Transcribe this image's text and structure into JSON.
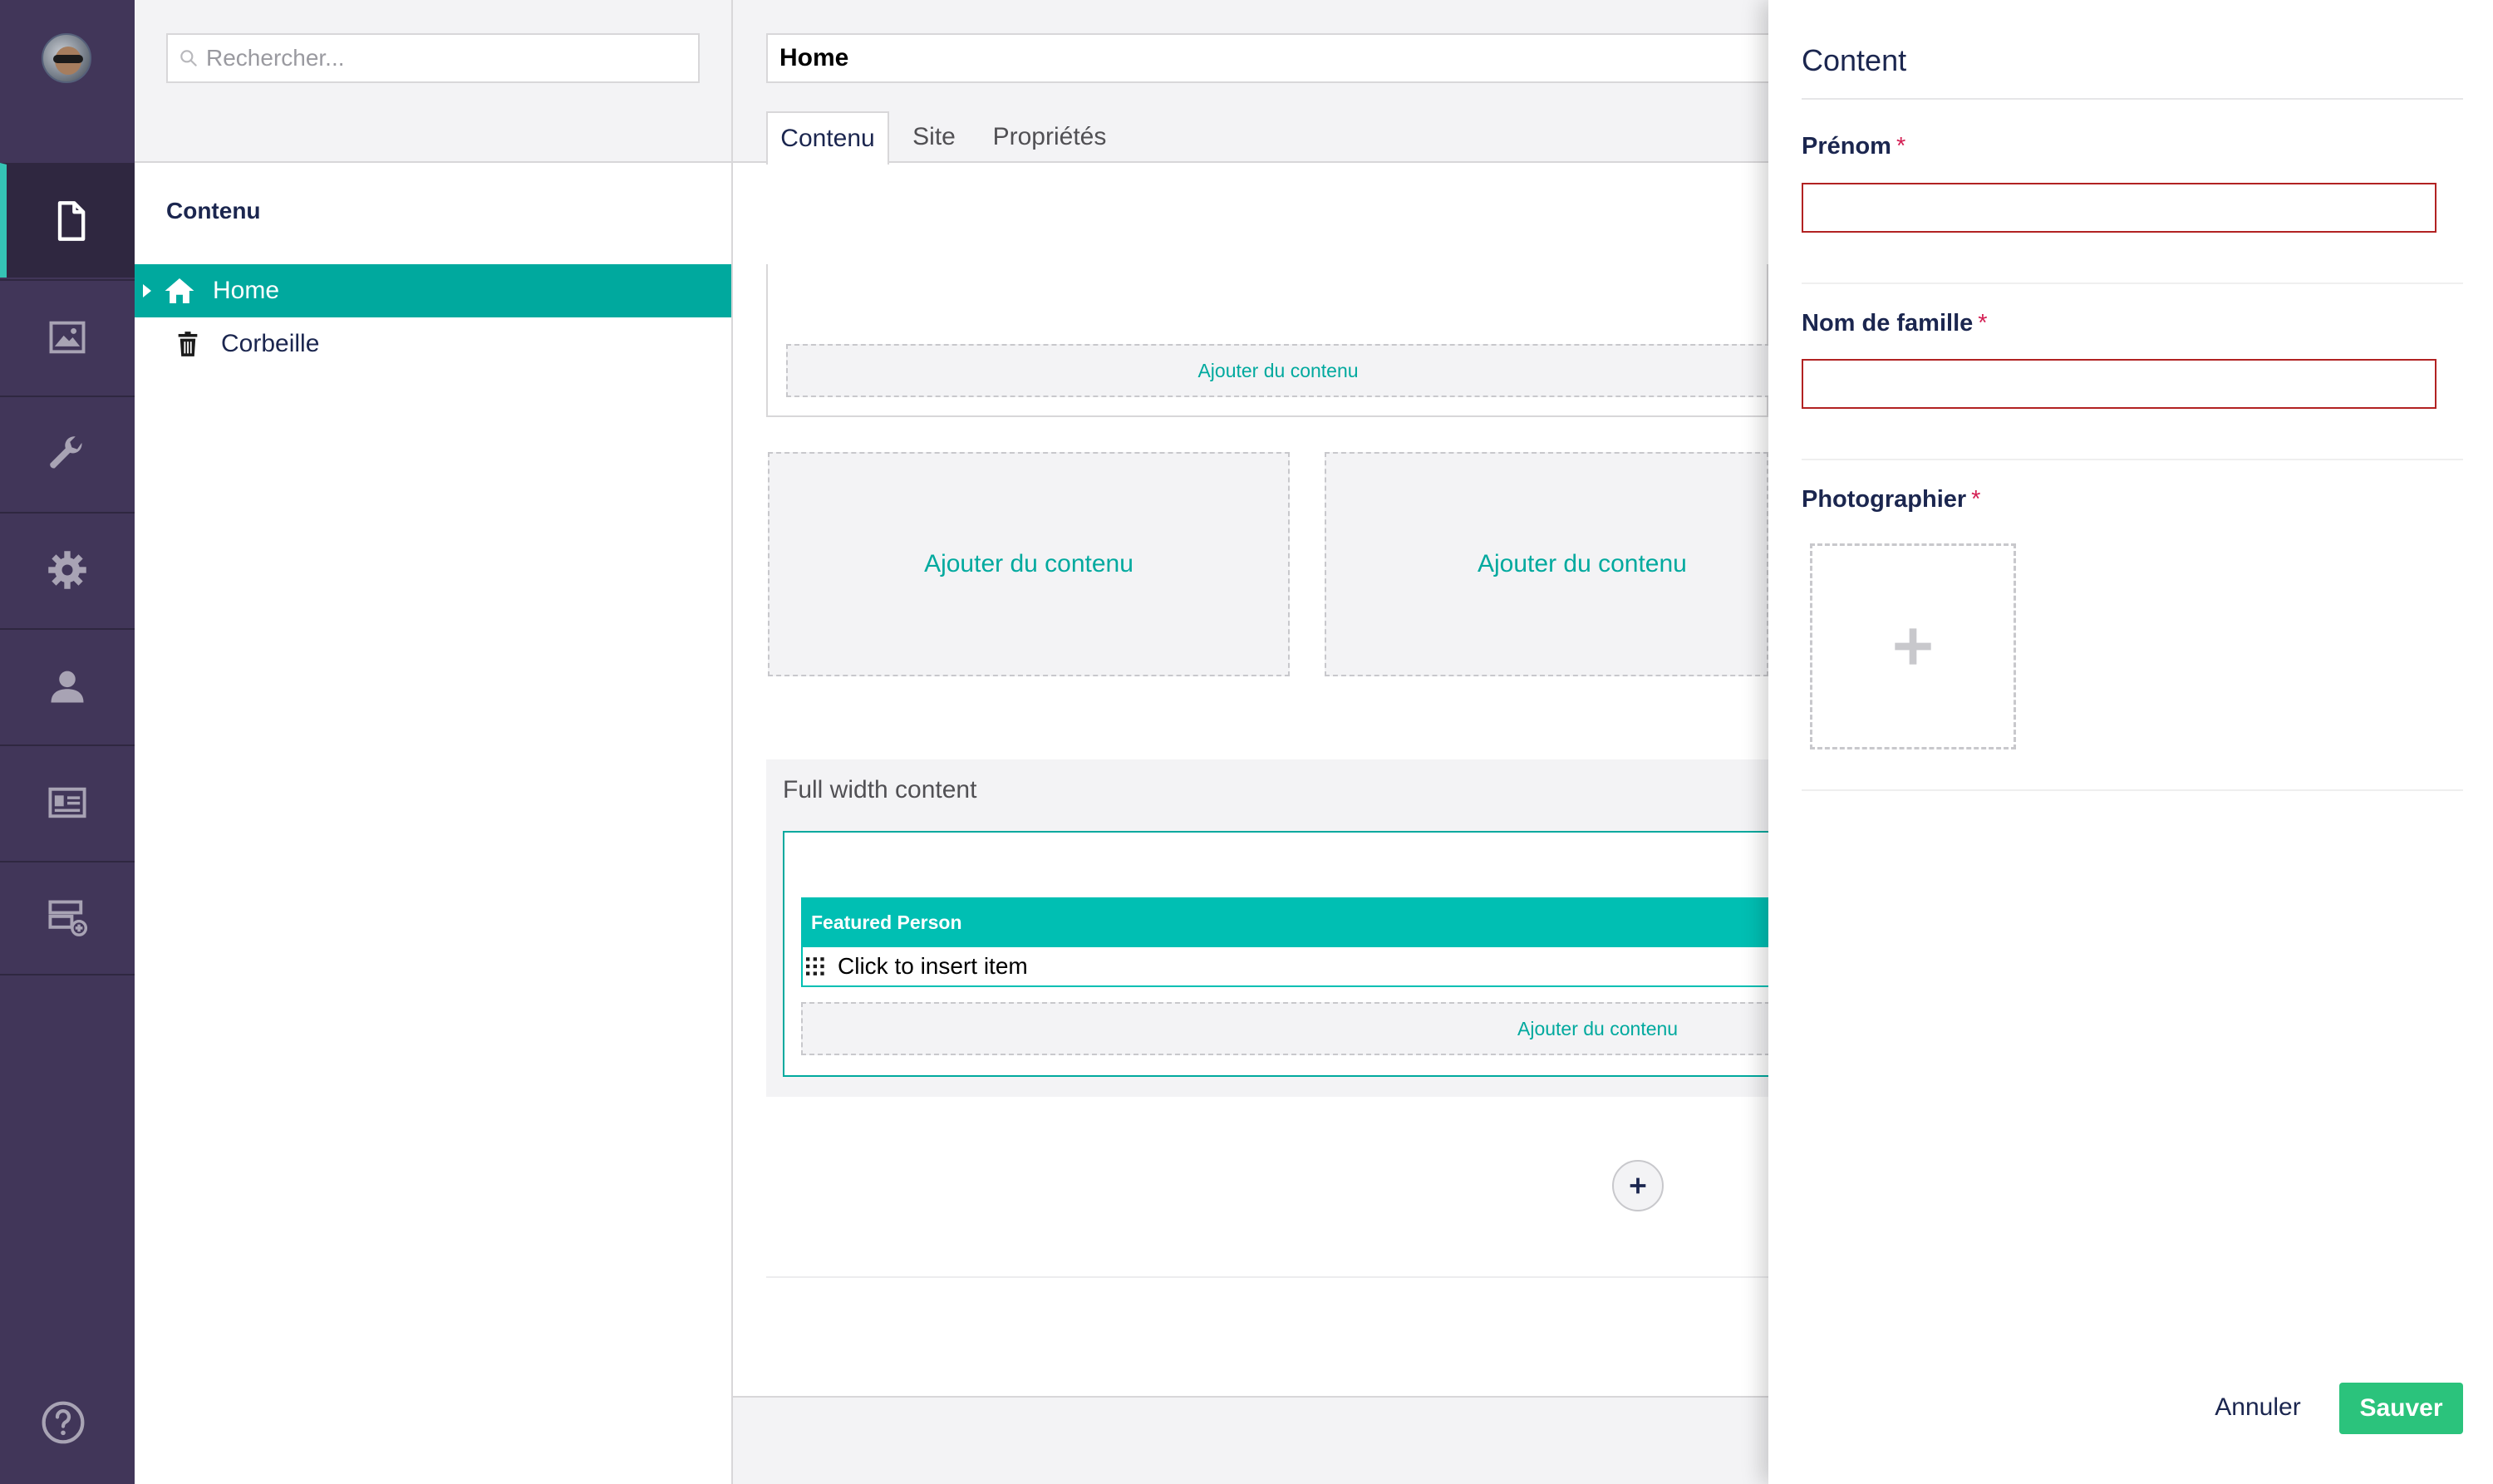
{
  "tree": {
    "search_placeholder": "Rechercher...",
    "section_title": "Contenu",
    "items": [
      {
        "label": "Home",
        "icon": "home-icon",
        "selected": true
      },
      {
        "label": "Corbeille",
        "icon": "trash-icon",
        "selected": false
      }
    ]
  },
  "editor": {
    "document_name": "Home",
    "tabs": [
      {
        "label": "Contenu",
        "active": true
      },
      {
        "label": "Site",
        "active": false
      },
      {
        "label": "Propriétés",
        "active": false
      }
    ],
    "add_content_label": "Ajouter du contenu",
    "full_width_section_title": "Full width content",
    "featured_block_title": "Featured Person",
    "insert_item_label": "Click to insert item"
  },
  "panel": {
    "title": "Content",
    "fields": [
      {
        "label": "Prénom",
        "required_marker": "*",
        "value": ""
      },
      {
        "label": "Nom de famille",
        "required_marker": "*",
        "value": ""
      },
      {
        "label": "Photographier",
        "required_marker": "*"
      }
    ],
    "cancel_label": "Annuler",
    "save_label": "Sauver"
  },
  "colors": {
    "nav_bg": "#413659",
    "accent_teal": "#00a99e",
    "save_green": "#2bc37c",
    "error_red": "#b22222",
    "required_red": "#d42054"
  }
}
